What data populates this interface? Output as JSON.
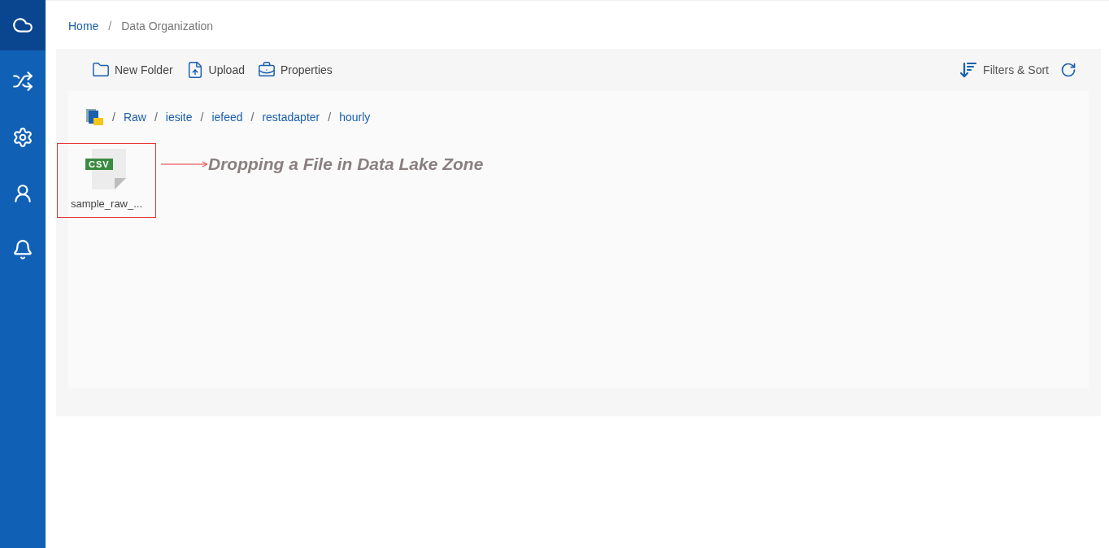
{
  "sidebar": {
    "items": [
      {
        "kind": "cloud",
        "selected": true
      },
      {
        "kind": "shuffle",
        "selected": false
      },
      {
        "kind": "gear",
        "selected": false
      },
      {
        "kind": "user",
        "selected": false
      },
      {
        "kind": "bell",
        "selected": false
      }
    ]
  },
  "breadcrumb_separator": "/",
  "breadcrumb": [
    "Home",
    "Data Organization"
  ],
  "toolbar": {
    "actions": [
      {
        "kind": "folder",
        "label": "New Folder"
      },
      {
        "kind": "upload",
        "label": "Upload"
      },
      {
        "kind": "properties",
        "label": "Properties"
      }
    ],
    "filters": "Filters & Sort"
  },
  "path_separator": "/",
  "path": [
    "Raw",
    "iesite",
    "iefeed",
    "restadapter",
    "hourly"
  ],
  "files": [
    {
      "type": "CSV",
      "name": "sample_raw_...",
      "highlighted": true
    }
  ],
  "annotation": "Dropping a File in Data Lake Zone"
}
